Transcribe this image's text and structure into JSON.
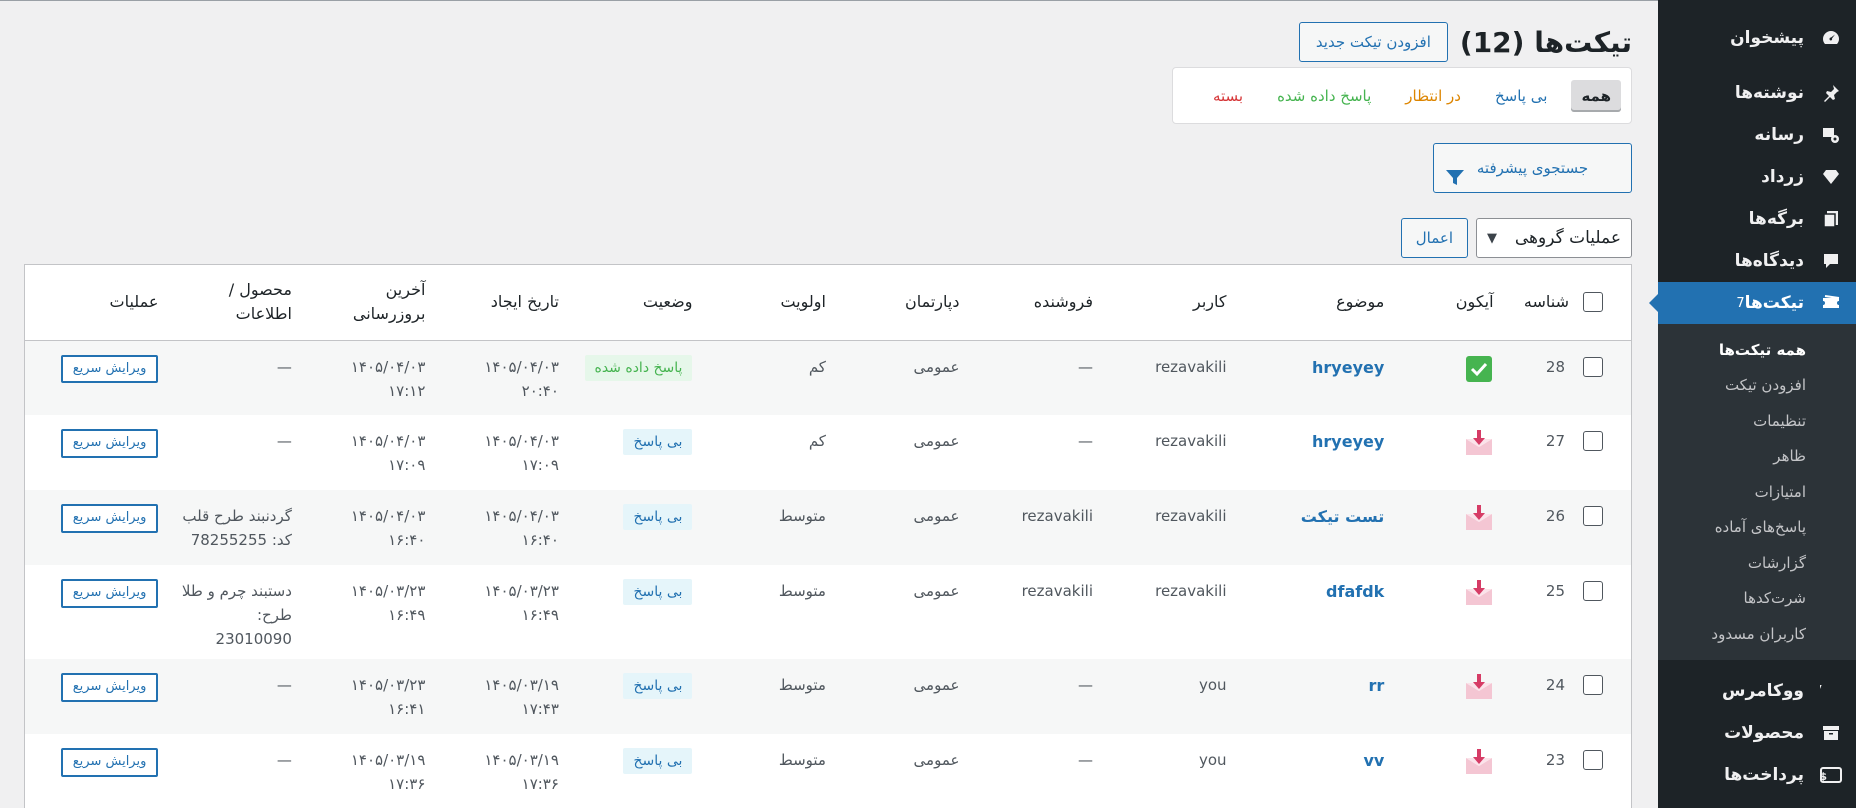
{
  "sidebar": {
    "menu_top": [
      {
        "label": "پیشخوان",
        "icon": "dashboard-icon"
      },
      {
        "label": "نوشته‌ها",
        "icon": "pin-icon"
      },
      {
        "label": "رسانه",
        "icon": "media-icon"
      },
      {
        "label": "زرداد",
        "icon": "diamond-icon"
      },
      {
        "label": "برگه‌ها",
        "icon": "pages-icon"
      },
      {
        "label": "دیدگاه‌ها",
        "icon": "comments-icon"
      }
    ],
    "active": {
      "label": "تیکت‌ها",
      "badge": "7",
      "icon": "tickets-icon"
    },
    "submenu": [
      "همه تیکت‌ها",
      "افزودن تیکت",
      "تنظیمات",
      "ظاهر",
      "امتیازات",
      "پاسخ‌های آماده",
      "گزارشات",
      "شرت‌کدها",
      "کاربران مسدود"
    ],
    "menu_bottom": [
      {
        "label": "ووکامرس",
        "icon": "woocommerce-icon"
      },
      {
        "label": "محصولات",
        "icon": "archive-icon"
      },
      {
        "label": "پرداخت‌ها",
        "icon": "payments-icon"
      }
    ]
  },
  "header": {
    "title": "تیکت‌ها (12)",
    "add_button": "افزودن تیکت جدید"
  },
  "filters": {
    "all": "همه",
    "unanswered": "بی پاسخ",
    "pending": "در انتظار",
    "answered": "پاسخ داده شده",
    "closed": "بسته"
  },
  "advanced_search": "جستجوی پیشرفته",
  "bulk": {
    "select": "عملیات گروهی",
    "apply": "اعمال"
  },
  "table": {
    "columns": {
      "id": "شناسه",
      "icon": "آیکون",
      "subject": "موضوع",
      "user": "کاربر",
      "seller": "فروشنده",
      "department": "دپارتمان",
      "priority": "اولویت",
      "status": "وضعیت",
      "created": "تاریخ ایجاد",
      "updated": "آخرین بروزرسانی",
      "product": "محصول / اطلاعات",
      "actions": "عملیات"
    },
    "rows": [
      {
        "id": "28",
        "icon": "answered",
        "subject": "hryeyey",
        "user": "rezavakili",
        "seller": "—",
        "department": "عمومی",
        "priority": "کم",
        "status": "پاسخ داده شده",
        "created": "۱۴۰۵/۰۴/۰۳ ۲۰:۴۰",
        "updated": "۱۴۰۵/۰۴/۰۳ ۱۷:۱۲",
        "product": "—",
        "action": "ویرایش سریع"
      },
      {
        "id": "27",
        "icon": "new",
        "subject": "hryeyey",
        "user": "rezavakili",
        "seller": "—",
        "department": "عمومی",
        "priority": "کم",
        "status": "بی پاسخ",
        "created": "۱۴۰۵/۰۴/۰۳ ۱۷:۰۹",
        "updated": "۱۴۰۵/۰۴/۰۳ ۱۷:۰۹",
        "product": "—",
        "action": "ویرایش سریع"
      },
      {
        "id": "26",
        "icon": "new",
        "subject": "تست تیکت",
        "user": "rezavakili",
        "seller": "rezavakili",
        "department": "عمومی",
        "priority": "متوسط",
        "status": "بی پاسخ",
        "created": "۱۴۰۵/۰۴/۰۳ ۱۶:۴۰",
        "updated": "۱۴۰۵/۰۴/۰۳ ۱۶:۴۰",
        "product": "گردنبند طرح قلب کد: 78255255",
        "action": "ویرایش سریع"
      },
      {
        "id": "25",
        "icon": "new",
        "subject": "dfafdk",
        "user": "rezavakili",
        "seller": "rezavakili",
        "department": "عمومی",
        "priority": "متوسط",
        "status": "بی پاسخ",
        "created": "۱۴۰۵/۰۳/۲۳ ۱۶:۴۹",
        "updated": "۱۴۰۵/۰۳/۲۳ ۱۶:۴۹",
        "product": "دستبند چرم و طلا طرح: 23010090",
        "action": "ویرایش سریع"
      },
      {
        "id": "24",
        "icon": "new",
        "subject": "rr",
        "user": "you",
        "seller": "—",
        "department": "عمومی",
        "priority": "متوسط",
        "status": "بی پاسخ",
        "created": "۱۴۰۵/۰۳/۱۹ ۱۷:۴۳",
        "updated": "۱۴۰۵/۰۳/۲۳ ۱۶:۴۱",
        "product": "—",
        "action": "ویرایش سریع"
      },
      {
        "id": "23",
        "icon": "new",
        "subject": "vv",
        "user": "you",
        "seller": "—",
        "department": "عمومی",
        "priority": "متوسط",
        "status": "بی پاسخ",
        "created": "۱۴۰۵/۰۳/۱۹ ۱۷:۳۶",
        "updated": "۱۴۰۵/۰۳/۱۹ ۱۷:۳۶",
        "product": "—",
        "action": "ویرایش سریع"
      }
    ]
  },
  "colors": {
    "accent": "#2271b1",
    "sidebar_bg": "#1d2327",
    "answered": "#46b450",
    "pending": "#dd8500",
    "closed": "#d63638"
  }
}
